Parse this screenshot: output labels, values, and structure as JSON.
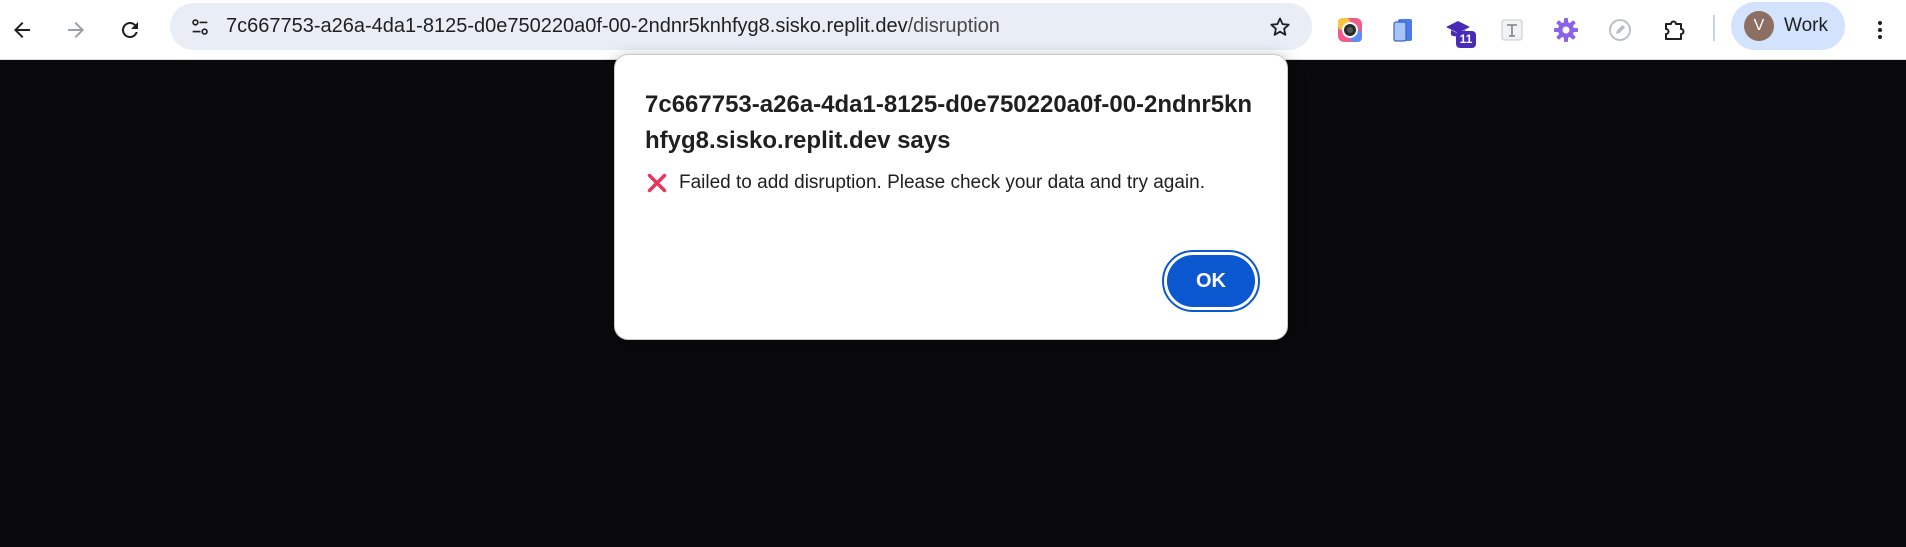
{
  "browser": {
    "omnibox": {
      "url_host": "7c667753-a26a-4da1-8125-d0e750220a0f-00-2ndnr5knhfyg8.sisko.replit.dev",
      "url_path": "/disruption"
    },
    "extensions": {
      "badge_count": "11"
    },
    "profile": {
      "initial": "V",
      "label": "Work"
    },
    "icons": {
      "back": "back-arrow-icon",
      "forward": "forward-arrow-icon",
      "reload": "reload-icon",
      "site_info": "tune-icon",
      "bookmark": "star-icon",
      "menu": "more-vertical-icon"
    }
  },
  "dialog": {
    "title": "7c667753-a26a-4da1-8125-d0e750220a0f-00-2ndnr5knhfyg8.sisko.replit.dev says",
    "message": "Failed to add disruption. Please check your data and try again.",
    "ok_label": "OK"
  },
  "colors": {
    "page_background": "#0a0a0c",
    "accent": "#0b57d0",
    "omnibox": "#e9eef6",
    "profile_chip": "#d3e3fd",
    "error_icon": "#e8345a"
  }
}
